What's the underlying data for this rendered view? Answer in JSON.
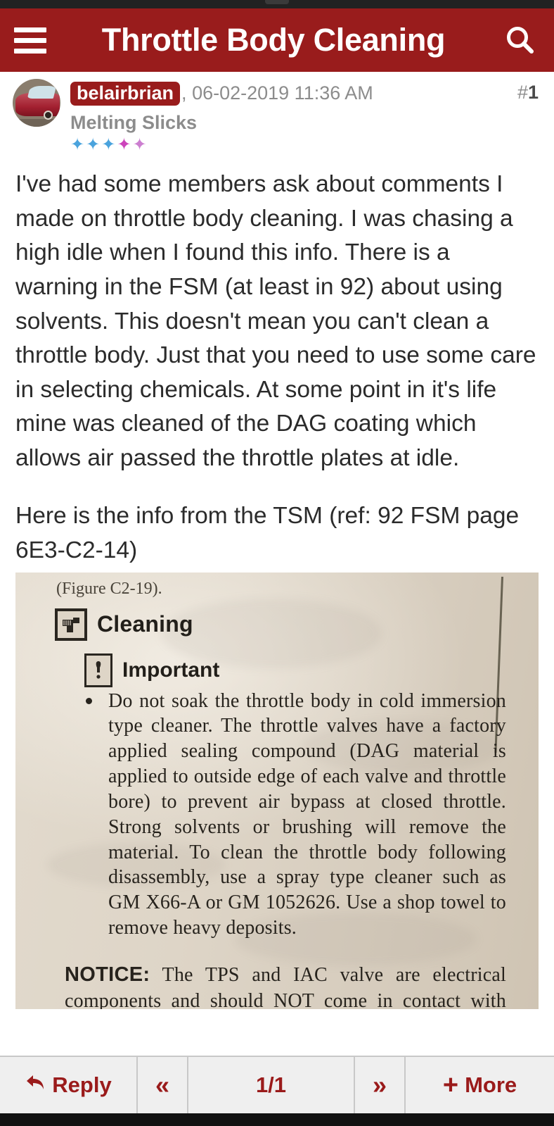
{
  "theme": {
    "accent": "#991c1c",
    "header_text": "#ffffff",
    "body_text": "#2b2b2b",
    "muted_text": "#8c8c8c",
    "toolbar_bg": "#efefef",
    "scan_paper": "#ded5c7"
  },
  "header": {
    "title": "Throttle Body Cleaning",
    "menu_icon": "hamburger-icon",
    "search_icon": "search-icon"
  },
  "post": {
    "username": "belairbrian",
    "date_separator": ", ",
    "timestamp": "06-02-2019 11:36 AM",
    "post_number_prefix": "#",
    "post_number": "1",
    "user_title": "Melting Slicks",
    "rating": {
      "count": 5,
      "filled_colors": [
        "#4aa3dd",
        "#4aa3dd",
        "#4aa3dd",
        "#cc44bb",
        "#cc7fd0"
      ]
    },
    "avatar_alt": "red-sports-car-avatar",
    "paragraphs": [
      "I've had some members ask about comments I made on throttle body cleaning. I was chasing a high idle when I found this info. There is a warning in the FSM (at least in 92) about using solvents. This doesn't mean you can't clean a throttle body. Just that you need to use some care in selecting chemicals. At some point in it's life mine was cleaned of the DAG coating which allows air passed the throttle plates at idle.",
      "Here is the info from the TSM (ref: 92 FSM page 6E3-C2-14)"
    ]
  },
  "scan": {
    "figure_ref": "(Figure C2-19).",
    "cleaning_heading": "Cleaning",
    "cleaning_icon": "spray-cleaner-icon",
    "important_label": "Important",
    "important_icon": "exclamation-box-icon",
    "important_body": "Do not soak the throttle body in cold immersion type cleaner. The throttle valves have a factory applied sealing compound (DAG material is applied to outside edge of each valve and throttle bore) to prevent air bypass at closed throttle. Strong solvents or brushing will remove the material. To clean the throttle body following disassembly, use a spray type cleaner such as GM X66-A or GM 1052626. Use a shop towel to remove heavy deposits.",
    "notice_label": "NOTICE:",
    "notice_body": "The TPS and IAC valve are electrical components and should NOT come in contact with solvent or cleaner, as they may be damaged."
  },
  "toolbar": {
    "reply_label": "Reply",
    "reply_icon": "reply-arrow-icon",
    "prev_icon": "double-chevron-left-icon",
    "page_indicator": "1/1",
    "next_icon": "double-chevron-right-icon",
    "more_label": "More",
    "more_icon": "plus-icon"
  }
}
